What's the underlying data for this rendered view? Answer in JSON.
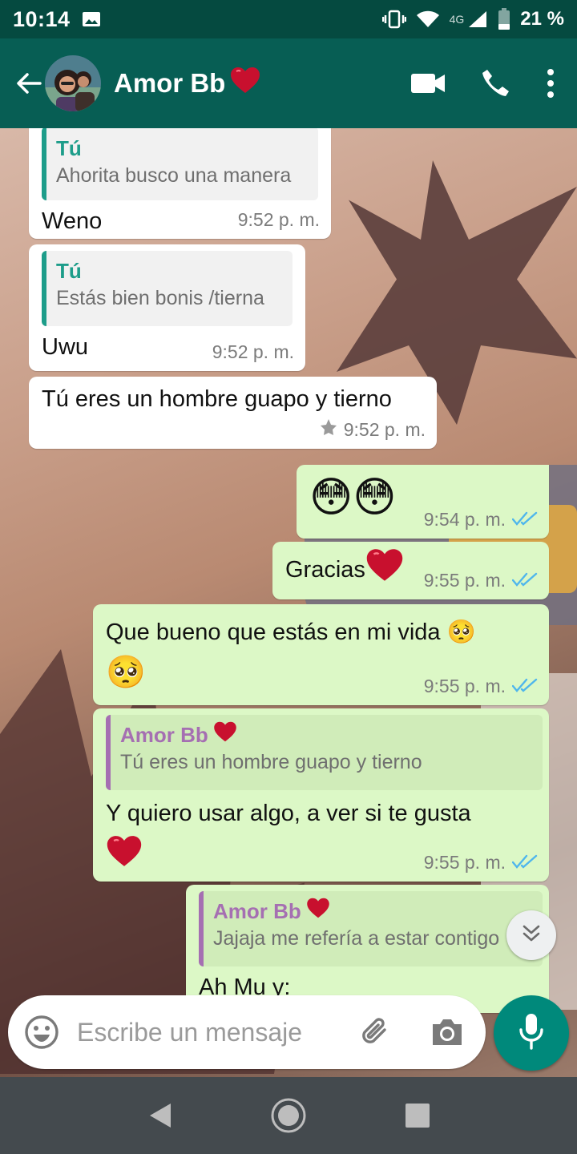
{
  "status_bar": {
    "time": "10:14",
    "network": "4G",
    "battery": "21 %",
    "icons": [
      "image-icon",
      "vibrate-icon",
      "wifi-icon",
      "signal-icon",
      "battery-icon"
    ]
  },
  "header": {
    "contact_name": "Amor Bb",
    "name_emoji": "❤",
    "icons": [
      "back-arrow-icon",
      "avatar",
      "video-call-icon",
      "phone-icon",
      "more-options-icon"
    ]
  },
  "messages": [
    {
      "direction": "in",
      "quote_name": "Tú",
      "quote_text": "Ahorita busco una manera",
      "text": "Weno",
      "time": "9:52 p. m."
    },
    {
      "direction": "in",
      "quote_name": "Tú",
      "quote_text": "Estás bien bonis /tierna",
      "text": "Uwu",
      "time": "9:52 p. m."
    },
    {
      "direction": "in",
      "text": "Tú eres un hombre guapo y tierno",
      "time": "9:52 p. m.",
      "starred": true
    },
    {
      "direction": "out",
      "text": "😳😳",
      "time": "9:54 p. m."
    },
    {
      "direction": "out",
      "text": "Gracias",
      "emoji": "❤",
      "time": "9:55 p. m."
    },
    {
      "direction": "out",
      "text": "Que bueno que estás en mi vida 🥺",
      "text2": "🥺",
      "time": "9:55 p. m."
    },
    {
      "direction": "out",
      "quote_name": "Amor Bb",
      "quote_text": "Tú eres un hombre guapo y tierno",
      "text": "Y quiero usar algo, a ver si te gusta",
      "text2": "❤",
      "time": "9:55 p. m."
    },
    {
      "direction": "out",
      "quote_name": "Amor Bb",
      "quote_text": "Jajaja me refería a estar contigo",
      "text": "Ah Mu y:",
      "time": ""
    }
  ],
  "composer": {
    "placeholder": "Escribe un mensaje"
  },
  "colors": {
    "status_bar": "#054a40",
    "app_bar": "#075e54",
    "outgoing_bubble": "#dcf8c6",
    "incoming_bubble": "#ffffff",
    "read_ticks": "#4fb6ec",
    "mic_button": "#00897b",
    "nav_bar": "#444a4e"
  }
}
